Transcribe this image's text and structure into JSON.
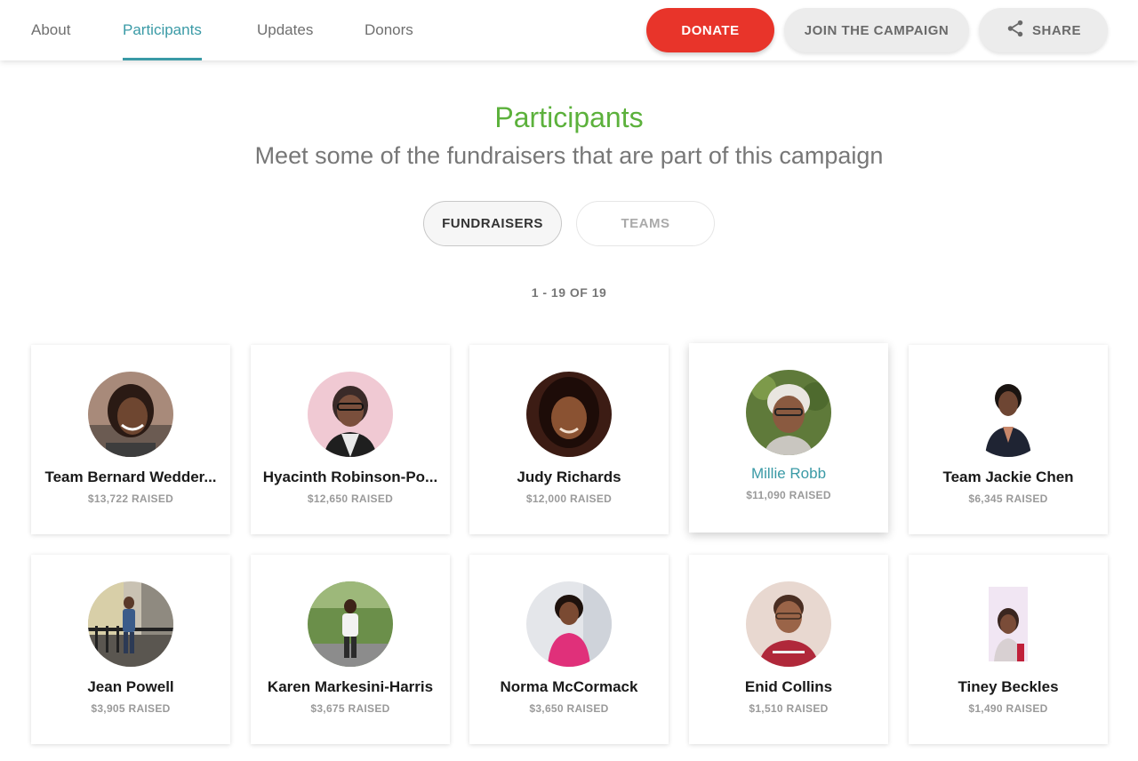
{
  "nav": {
    "links": [
      {
        "label": "About",
        "active": false
      },
      {
        "label": "Participants",
        "active": true
      },
      {
        "label": "Updates",
        "active": false
      },
      {
        "label": "Donors",
        "active": false
      }
    ],
    "donate_label": "DONATE",
    "join_label": "JOIN THE CAMPAIGN",
    "share_label": "SHARE"
  },
  "header": {
    "title": "Participants",
    "subtitle": "Meet some of the fundraisers that are part of this campaign"
  },
  "toggle": {
    "fundraisers_label": "FUNDRAISERS",
    "teams_label": "TEAMS",
    "selected": "FUNDRAISERS"
  },
  "results": {
    "count_label": "1 - 19 OF 19"
  },
  "participants": [
    {
      "name": "Team Bernard Wedder...",
      "raised": "$13,722 RAISED"
    },
    {
      "name": "Hyacinth Robinson-Po...",
      "raised": "$12,650 RAISED"
    },
    {
      "name": "Judy Richards",
      "raised": "$12,000 RAISED"
    },
    {
      "name": "Millie Robb",
      "raised": "$11,090 RAISED"
    },
    {
      "name": "Team Jackie Chen",
      "raised": "$6,345 RAISED"
    },
    {
      "name": "Jean Powell",
      "raised": "$3,905 RAISED"
    },
    {
      "name": "Karen Markesini-Harris",
      "raised": "$3,675 RAISED"
    },
    {
      "name": "Norma McCormack",
      "raised": "$3,650 RAISED"
    },
    {
      "name": "Enid Collins",
      "raised": "$1,510 RAISED"
    },
    {
      "name": "Tiney Beckles",
      "raised": "$1,490 RAISED"
    }
  ],
  "colors": {
    "accent": "#3a9aa6",
    "title_green": "#5cb13c",
    "donate_red": "#e8342a"
  },
  "icons": {
    "share": "share-icon"
  }
}
